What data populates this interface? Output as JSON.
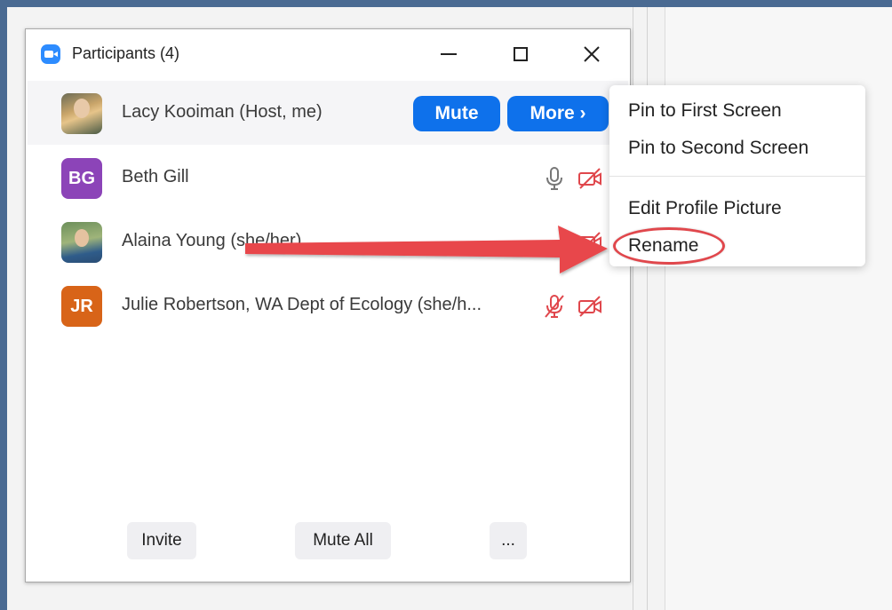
{
  "window": {
    "title": "Participants (4)"
  },
  "participants": [
    {
      "name": "Lacy Kooiman (Host, me)",
      "avatar": "photo",
      "mute_label": "Mute",
      "more_label": "More ›"
    },
    {
      "name": "Beth Gill",
      "initials": "BG",
      "avatar_color": "#8c44b8",
      "mic": "microphone-icon",
      "video": "video-off-icon"
    },
    {
      "name": "Alaina Young (she/her)",
      "avatar": "photo",
      "video": "video-off-icon"
    },
    {
      "name": "Julie Robertson, WA Dept of Ecology (she/h...",
      "initials": "JR",
      "avatar_color": "#d86418",
      "mic": "microphone-muted-icon",
      "video": "video-off-icon"
    }
  ],
  "footer": {
    "invite_label": "Invite",
    "mute_all_label": "Mute All",
    "more_label": "..."
  },
  "context_menu": {
    "items": [
      "Pin to First Screen",
      "Pin to Second Screen",
      "Edit Profile Picture",
      "Rename"
    ],
    "highlighted": "Rename"
  },
  "colors": {
    "accent": "#0e71eb",
    "annotation": "#e0474c",
    "muted_red": "#e0474c"
  }
}
